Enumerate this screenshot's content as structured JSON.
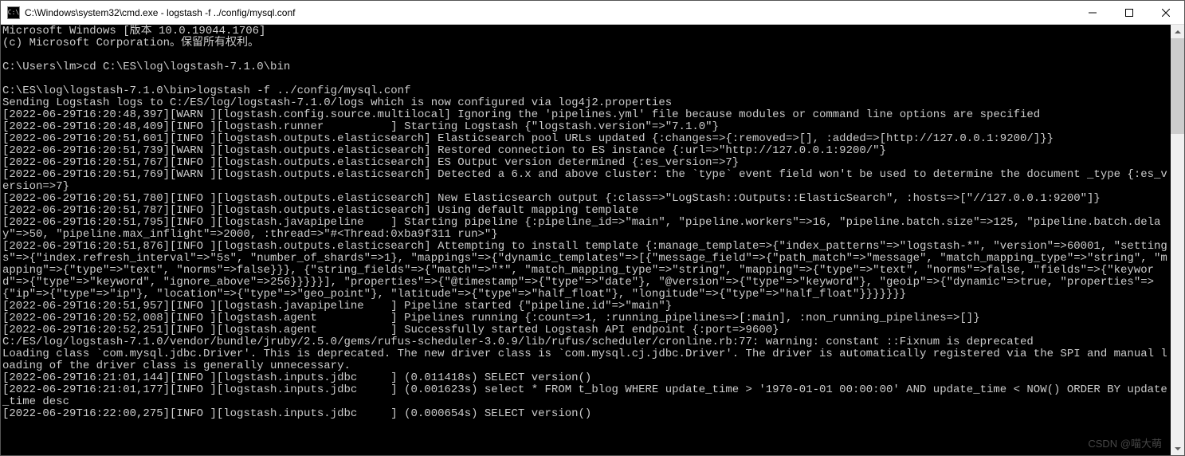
{
  "titlebar": {
    "icon_glyph": "C:\\",
    "title": "C:\\Windows\\system32\\cmd.exe - logstash  -f ../config/mysql.conf"
  },
  "win_controls": {
    "minimize": "—",
    "maximize": "□",
    "close": "✕"
  },
  "watermark": "CSDN @喵大萌",
  "terminal_lines": [
    "Microsoft Windows [版本 10.0.19044.1706]",
    "(c) Microsoft Corporation。保留所有权利。",
    "",
    "C:\\Users\\lm>cd C:\\ES\\log\\logstash-7.1.0\\bin",
    "",
    "C:\\ES\\log\\logstash-7.1.0\\bin>logstash -f ../config/mysql.conf",
    "Sending Logstash logs to C:/ES/log/logstash-7.1.0/logs which is now configured via log4j2.properties",
    "[2022-06-29T16:20:48,397][WARN ][logstash.config.source.multilocal] Ignoring the 'pipelines.yml' file because modules or command line options are specified",
    "[2022-06-29T16:20:48,409][INFO ][logstash.runner          ] Starting Logstash {\"logstash.version\"=>\"7.1.0\"}",
    "[2022-06-29T16:20:51,601][INFO ][logstash.outputs.elasticsearch] Elasticsearch pool URLs updated {:changes=>{:removed=>[], :added=>[http://127.0.0.1:9200/]}}",
    "[2022-06-29T16:20:51,739][WARN ][logstash.outputs.elasticsearch] Restored connection to ES instance {:url=>\"http://127.0.0.1:9200/\"}",
    "[2022-06-29T16:20:51,767][INFO ][logstash.outputs.elasticsearch] ES Output version determined {:es_version=>7}",
    "[2022-06-29T16:20:51,769][WARN ][logstash.outputs.elasticsearch] Detected a 6.x and above cluster: the `type` event field won't be used to determine the document _type {:es_version=>7}",
    "[2022-06-29T16:20:51,780][INFO ][logstash.outputs.elasticsearch] New Elasticsearch output {:class=>\"LogStash::Outputs::ElasticSearch\", :hosts=>[\"//127.0.0.1:9200\"]}",
    "[2022-06-29T16:20:51,787][INFO ][logstash.outputs.elasticsearch] Using default mapping template",
    "[2022-06-29T16:20:51,795][INFO ][logstash.javapipeline    ] Starting pipeline {:pipeline_id=>\"main\", \"pipeline.workers\"=>16, \"pipeline.batch.size\"=>125, \"pipeline.batch.delay\"=>50, \"pipeline.max_inflight\"=>2000, :thread=>\"#<Thread:0xba9f311 run>\"}",
    "[2022-06-29T16:20:51,876][INFO ][logstash.outputs.elasticsearch] Attempting to install template {:manage_template=>{\"index_patterns\"=>\"logstash-*\", \"version\"=>60001, \"settings\"=>{\"index.refresh_interval\"=>\"5s\", \"number_of_shards\"=>1}, \"mappings\"=>{\"dynamic_templates\"=>[{\"message_field\"=>{\"path_match\"=>\"message\", \"match_mapping_type\"=>\"string\", \"mapping\"=>{\"type\"=>\"text\", \"norms\"=>false}}}, {\"string_fields\"=>{\"match\"=>\"*\", \"match_mapping_type\"=>\"string\", \"mapping\"=>{\"type\"=>\"text\", \"norms\"=>false, \"fields\"=>{\"keyword\"=>{\"type\"=>\"keyword\", \"ignore_above\"=>256}}}}}], \"properties\"=>{\"@timestamp\"=>{\"type\"=>\"date\"}, \"@version\"=>{\"type\"=>\"keyword\"}, \"geoip\"=>{\"dynamic\"=>true, \"properties\"=>{\"ip\"=>{\"type\"=>\"ip\"}, \"location\"=>{\"type\"=>\"geo_point\"}, \"latitude\"=>{\"type\"=>\"half_float\"}, \"longitude\"=>{\"type\"=>\"half_float\"}}}}}}}",
    "[2022-06-29T16:20:51,957][INFO ][logstash.javapipeline    ] Pipeline started {\"pipeline.id\"=>\"main\"}",
    "[2022-06-29T16:20:52,008][INFO ][logstash.agent           ] Pipelines running {:count=>1, :running_pipelines=>[:main], :non_running_pipelines=>[]}",
    "[2022-06-29T16:20:52,251][INFO ][logstash.agent           ] Successfully started Logstash API endpoint {:port=>9600}",
    "C:/ES/log/logstash-7.1.0/vendor/bundle/jruby/2.5.0/gems/rufus-scheduler-3.0.9/lib/rufus/scheduler/cronline.rb:77: warning: constant ::Fixnum is deprecated",
    "Loading class `com.mysql.jdbc.Driver'. This is deprecated. The new driver class is `com.mysql.cj.jdbc.Driver'. The driver is automatically registered via the SPI and manual loading of the driver class is generally unnecessary.",
    "[2022-06-29T16:21:01,144][INFO ][logstash.inputs.jdbc     ] (0.011418s) SELECT version()",
    "[2022-06-29T16:21:01,177][INFO ][logstash.inputs.jdbc     ] (0.001623s) select * FROM t_blog WHERE update_time > '1970-01-01 00:00:00' AND update_time < NOW() ORDER BY update_time desc",
    "[2022-06-29T16:22:00,275][INFO ][logstash.inputs.jdbc     ] (0.000654s) SELECT version()"
  ]
}
